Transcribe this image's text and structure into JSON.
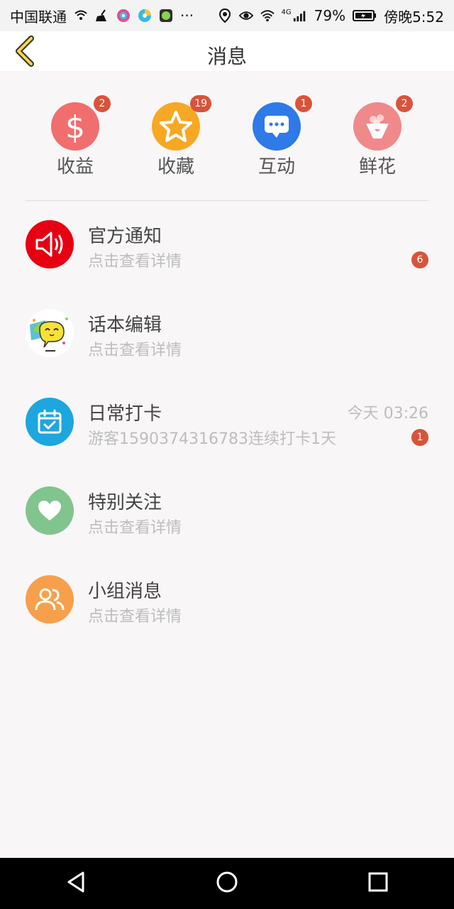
{
  "status_bar": {
    "carrier": "中国联通",
    "battery": "79%",
    "time": "傍晚5:52",
    "network": "4G",
    "more": "···"
  },
  "header": {
    "title": "消息"
  },
  "categories": [
    {
      "label": "收益",
      "badge": "2",
      "color": "#f16e6e",
      "icon": "dollar-icon"
    },
    {
      "label": "收藏",
      "badge": "19",
      "color": "#f7a823",
      "icon": "star-icon"
    },
    {
      "label": "互动",
      "badge": "1",
      "color": "#2d7ae8",
      "icon": "chat-icon"
    },
    {
      "label": "鲜花",
      "badge": "2",
      "color": "#f08a8a",
      "icon": "flower-icon"
    }
  ],
  "messages": [
    {
      "title": "官方通知",
      "subtitle": "点击查看详情",
      "time": "",
      "badge": "6",
      "color": "#e60012",
      "icon": "speaker-icon"
    },
    {
      "title": "话本编辑",
      "subtitle": "点击查看详情",
      "time": "",
      "badge": "",
      "color": "#ffffff",
      "icon": "editor-avatar-icon"
    },
    {
      "title": "日常打卡",
      "subtitle": "游客1590374316783连续打卡1天",
      "time": "今天 03:26",
      "badge": "1",
      "color": "#1ea6df",
      "icon": "calendar-check-icon"
    },
    {
      "title": "特别关注",
      "subtitle": "点击查看详情",
      "time": "",
      "badge": "",
      "color": "#82c48e",
      "icon": "heart-icon"
    },
    {
      "title": "小组消息",
      "subtitle": "点击查看详情",
      "time": "",
      "badge": "",
      "color": "#f7a04c",
      "icon": "group-icon"
    }
  ]
}
